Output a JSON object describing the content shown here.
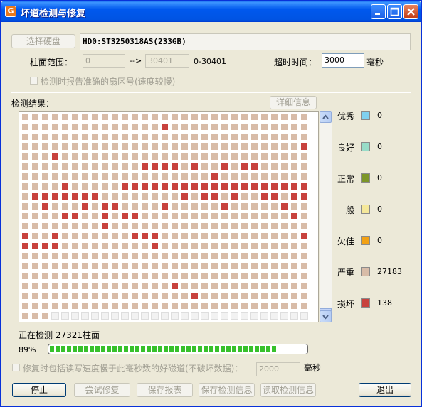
{
  "window": {
    "title": "坏道检测与修复",
    "app_icon_letter": "G"
  },
  "top": {
    "select_disk_label": "选择硬盘",
    "disk_name": "HD0:ST3250318AS(233GB)",
    "cylinder_range_label": "柱面范围：",
    "cyl_from": "0",
    "arrow": "-->",
    "cyl_to": "30401",
    "cyl_range_text": "0-30401",
    "timeout_label": "超时时间：",
    "timeout_value": "3000",
    "timeout_unit": "毫秒",
    "report_sector_label": "检测时报告准确的扇区号(速度较慢)"
  },
  "results": {
    "label": "检测结果：",
    "details_button": "详细信息"
  },
  "legend": [
    {
      "label": "优秀",
      "color": "#7fd0f0",
      "count": "0"
    },
    {
      "label": "良好",
      "color": "#98dcc8",
      "count": "0"
    },
    {
      "label": "正常",
      "color": "#7c9628",
      "count": "0"
    },
    {
      "label": "一般",
      "color": "#f5e89a",
      "count": "0"
    },
    {
      "label": "欠佳",
      "color": "#f2a114",
      "count": "0"
    },
    {
      "label": "严重",
      "color": "#d8bca8",
      "count": "27183"
    },
    {
      "label": "损坏",
      "color": "#c8423e",
      "count": "138"
    }
  ],
  "status": {
    "checking_text": "正在检测 27321柱面",
    "percent_text": "89%",
    "progress_fraction": 0.89
  },
  "repair": {
    "option_label": "修复时包括读写速度慢于此毫秒数的好磁道(不破坏数据)：",
    "threshold_value": "2000",
    "threshold_unit": "毫秒"
  },
  "buttons": {
    "stop": "停止",
    "try_repair": "尝试修复",
    "save_report": "保存报表",
    "save_info": "保存检测信息",
    "load_info": "读取检测信息",
    "exit": "退出"
  },
  "colors": {
    "severe": "#d8bca8",
    "bad": "#c8423e",
    "unchecked": "#f2f2f2"
  },
  "grid": {
    "columns": 29,
    "rows": 21,
    "damaged_cells": [
      [
        1,
        14
      ],
      [
        3,
        28
      ],
      [
        4,
        3
      ],
      [
        5,
        12
      ],
      [
        5,
        13
      ],
      [
        5,
        14
      ],
      [
        5,
        15
      ],
      [
        5,
        17
      ],
      [
        5,
        20
      ],
      [
        5,
        22
      ],
      [
        5,
        23
      ],
      [
        6,
        19
      ],
      [
        7,
        4
      ],
      [
        7,
        10
      ],
      [
        7,
        11
      ],
      [
        7,
        12
      ],
      [
        7,
        13
      ],
      [
        7,
        14
      ],
      [
        7,
        15
      ],
      [
        7,
        16
      ],
      [
        7,
        17
      ],
      [
        7,
        18
      ],
      [
        7,
        19
      ],
      [
        7,
        20
      ],
      [
        7,
        21
      ],
      [
        7,
        22
      ],
      [
        7,
        23
      ],
      [
        7,
        24
      ],
      [
        7,
        25
      ],
      [
        7,
        26
      ],
      [
        7,
        27
      ],
      [
        7,
        28
      ],
      [
        8,
        1
      ],
      [
        8,
        2
      ],
      [
        8,
        3
      ],
      [
        8,
        4
      ],
      [
        8,
        5
      ],
      [
        8,
        6
      ],
      [
        8,
        7
      ],
      [
        8,
        16
      ],
      [
        8,
        18
      ],
      [
        8,
        19
      ],
      [
        8,
        21
      ],
      [
        8,
        24
      ],
      [
        8,
        25
      ],
      [
        8,
        27
      ],
      [
        8,
        28
      ],
      [
        9,
        2
      ],
      [
        9,
        6
      ],
      [
        9,
        8
      ],
      [
        9,
        9
      ],
      [
        9,
        14
      ],
      [
        9,
        20
      ],
      [
        9,
        26
      ],
      [
        10,
        4
      ],
      [
        10,
        5
      ],
      [
        10,
        8
      ],
      [
        10,
        10
      ],
      [
        10,
        11
      ],
      [
        10,
        27
      ],
      [
        11,
        8
      ],
      [
        12,
        0
      ],
      [
        12,
        3
      ],
      [
        12,
        11
      ],
      [
        12,
        12
      ],
      [
        12,
        13
      ],
      [
        12,
        28
      ],
      [
        13,
        0
      ],
      [
        13,
        1
      ],
      [
        13,
        2
      ],
      [
        13,
        3
      ],
      [
        13,
        13
      ],
      [
        17,
        15
      ],
      [
        18,
        17
      ]
    ],
    "last_row_checked": 3
  }
}
